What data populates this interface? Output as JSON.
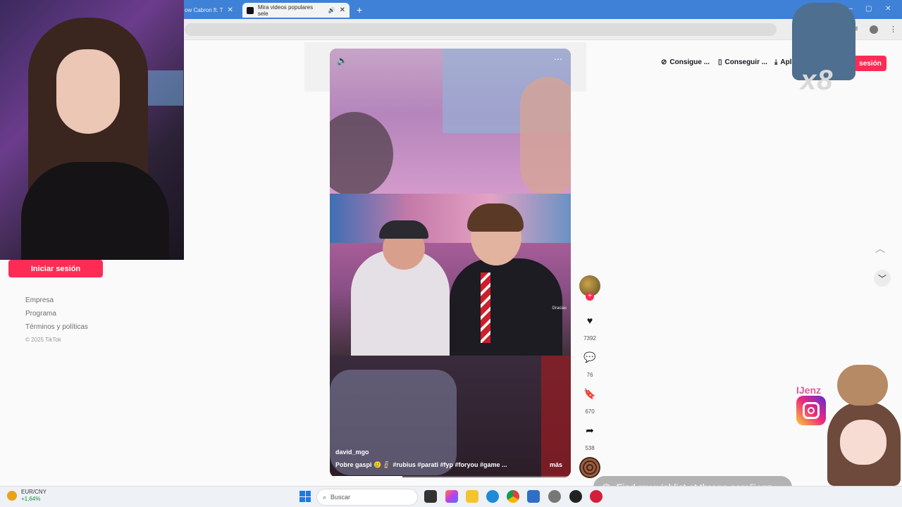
{
  "browser": {
    "tabs": [
      {
        "label": "ow Cabron ft. T"
      },
      {
        "label": "Mira videos populares sele"
      }
    ],
    "new_tab": "+"
  },
  "header": {
    "coins": "Consigue ...",
    "get_app": "Conseguir ...",
    "download": "Aplic",
    "login": "sesión"
  },
  "sidebar": {
    "login": "Iniciar sesión",
    "links": [
      "Empresa",
      "Programa",
      "Términos y políticas"
    ],
    "copyright": "© 2025 TikTok"
  },
  "video": {
    "author": "david_mgo",
    "caption": "Pobre gaspi 🥲 🗿 #rubius #parati #fyp #foryou #game ...",
    "more": "más",
    "overlay_text": "Gracias"
  },
  "actions": {
    "likes": "7392",
    "comments": "76",
    "saves": "670",
    "shares": "538"
  },
  "overlays": {
    "sticker_multiplier": "x8",
    "instagram_handle": "IJenz",
    "throne_text": "Find my wishlist at throne.com/ijenz"
  },
  "taskbar": {
    "fx_pair": "EUR/CNY",
    "fx_change": "+1,64%",
    "search_placeholder": "Buscar"
  },
  "colors": {
    "accent": "#fe2c55",
    "browser_bar": "#3f81d6"
  }
}
